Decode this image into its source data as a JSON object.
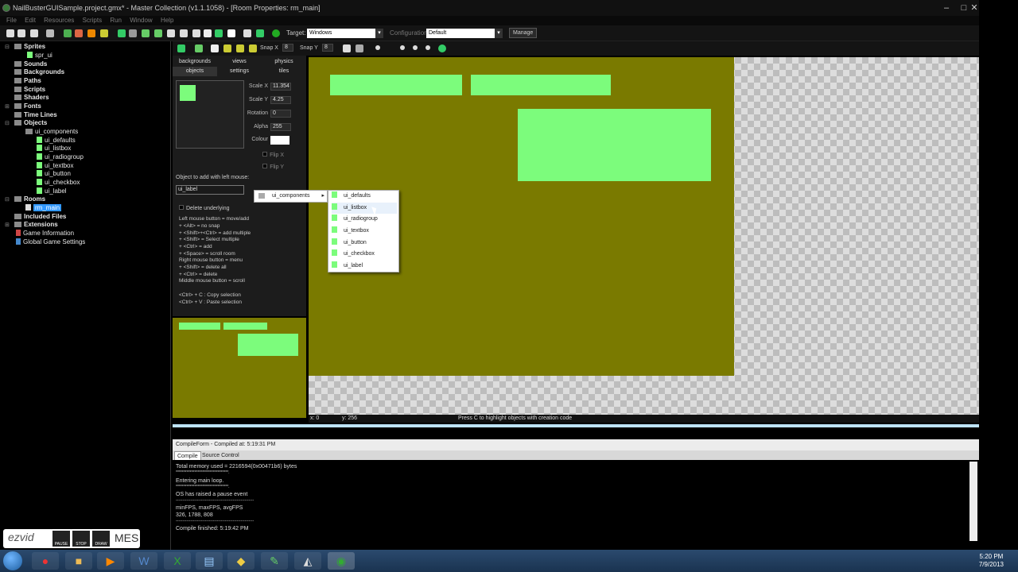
{
  "window": {
    "title": "NailBusterGUISample.project.gmx* - Master Collection (v1.1.1058) - [Room Properties: rm_main]",
    "controls": [
      "–",
      "□",
      "✕"
    ]
  },
  "menu": [
    "File",
    "Edit",
    "Resources",
    "Scripts",
    "Run",
    "Window",
    "Help"
  ],
  "toolbar": {
    "target_label": "Target:",
    "target_value": "Windows",
    "config_label": "Configuration:",
    "config_value": "Default",
    "manage_label": "Manage"
  },
  "tree": {
    "items": [
      {
        "label": "Sprites",
        "bold": true,
        "kind": "folder"
      },
      {
        "label": "spr_ui",
        "bold": false,
        "kind": "leaf"
      },
      {
        "label": "Sounds",
        "bold": true,
        "kind": "folder"
      },
      {
        "label": "Backgrounds",
        "bold": true,
        "kind": "folder"
      },
      {
        "label": "Paths",
        "bold": true,
        "kind": "folder"
      },
      {
        "label": "Scripts",
        "bold": true,
        "kind": "folder"
      },
      {
        "label": "Shaders",
        "bold": true,
        "kind": "folder"
      },
      {
        "label": "Fonts",
        "bold": true,
        "kind": "folder"
      },
      {
        "label": "Time Lines",
        "bold": true,
        "kind": "folder"
      },
      {
        "label": "Objects",
        "bold": true,
        "kind": "folder"
      },
      {
        "label": "ui_components",
        "bold": false,
        "kind": "folder"
      },
      {
        "label": "ui_defaults",
        "bold": false,
        "kind": "leaf"
      },
      {
        "label": "ui_listbox",
        "bold": false,
        "kind": "leaf"
      },
      {
        "label": "ui_radiogroup",
        "bold": false,
        "kind": "leaf"
      },
      {
        "label": "ui_textbox",
        "bold": false,
        "kind": "leaf"
      },
      {
        "label": "ui_button",
        "bold": false,
        "kind": "leaf"
      },
      {
        "label": "ui_checkbox",
        "bold": false,
        "kind": "leaf"
      },
      {
        "label": "ui_label",
        "bold": false,
        "kind": "leaf"
      },
      {
        "label": "Rooms",
        "bold": true,
        "kind": "folder"
      },
      {
        "label": "rm_main",
        "bold": false,
        "kind": "selected"
      },
      {
        "label": "Included Files",
        "bold": true,
        "kind": "folder"
      },
      {
        "label": "Extensions",
        "bold": true,
        "kind": "folder"
      },
      {
        "label": "Game Information",
        "bold": false,
        "kind": "info"
      },
      {
        "label": "Global Game Settings",
        "bold": false,
        "kind": "info"
      }
    ]
  },
  "room_toolbar": {
    "snapx_label": "Snap X",
    "snapx_value": "8",
    "snapy_label": "Snap Y",
    "snapy_value": "8"
  },
  "room_tabs": {
    "row1": [
      "backgrounds",
      "views",
      "physics"
    ],
    "row2": [
      "objects",
      "settings",
      "tiles"
    ]
  },
  "props": {
    "scalex_label": "Scale X",
    "scalex_value": "11.354",
    "scaley_label": "Scale Y",
    "scaley_value": "4.25",
    "rotation_label": "Rotation",
    "rotation_value": "0",
    "alpha_label": "Alpha",
    "alpha_value": "255",
    "colour_label": "Colour",
    "flipx_label": "Flip X",
    "flipy_label": "Flip Y"
  },
  "object_add": {
    "label": "Object to add with left mouse:",
    "value": "ui_label",
    "delete_underlying": "Delete underlying"
  },
  "help_lines": [
    "Left mouse button = move/add",
    "  + <Alt> = no snap",
    "  + <Shift>+<Ctrl> = add multiple",
    "  + <Shift> = Select multiple",
    "  + <Ctrl> = add",
    "  + <Space> = scroll room",
    "Right mouse button = menu",
    "  + <Shift> = delete all",
    "  + <Ctrl> = delete",
    "Middle mouse button = scroll",
    "",
    "<Ctrl> + C : Copy selection",
    "<Ctrl> + V : Paste selection"
  ],
  "dropdown": {
    "group": "ui_components",
    "items": [
      "ui_defaults",
      "ui_listbox",
      "ui_radiogroup",
      "ui_textbox",
      "ui_button",
      "ui_checkbox",
      "ui_label"
    ],
    "hovered": "ui_listbox"
  },
  "status": {
    "x": "x: 0",
    "y": "y: 256",
    "hint": "Press C to highlight objects with creation code"
  },
  "compile": {
    "title": "CompileForm - Compiled at: 5:19:31 PM",
    "tabs": [
      "Compile",
      "Source Control"
    ],
    "lines": [
      "Total memory used = 2216594(0x00471b6) bytes",
      "**********************************.",
      "Entering main loop.",
      "**********************************.",
      "OS has raised a pause event",
      "-----------------------------------------------------------",
      "minFPS, maxFPS, avgFPS",
      "326, 1788, 808",
      "-----------------------------------------------------------",
      "Compile finished: 5:19:42 PM"
    ]
  },
  "recorder": {
    "brand": "ezvid",
    "pause": "PAUSE",
    "stop": "STOP",
    "draw": "DRAW",
    "trailing": "MES"
  },
  "taskbar": {
    "time": "5:20 PM",
    "date": "7/9/2013"
  },
  "colors": {
    "room_bg": "#7a7a00",
    "object": "#7cfc7c",
    "selection": "#3399ff"
  }
}
